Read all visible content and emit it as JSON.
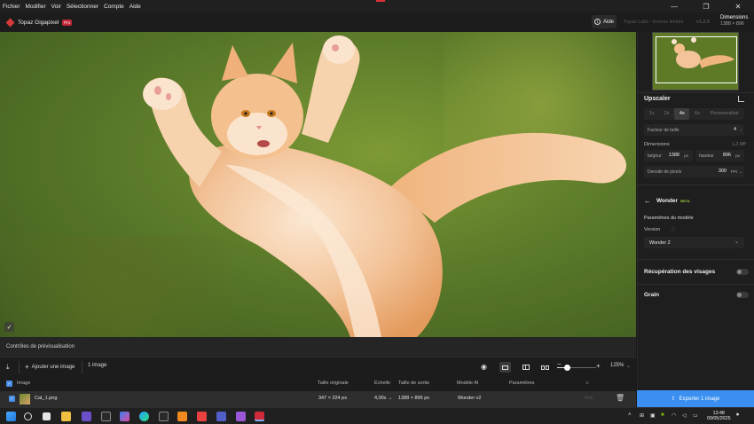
{
  "menubar": {
    "items": [
      "Fichier",
      "Modifier",
      "Voir",
      "Sélectionner",
      "Compte",
      "Aide"
    ]
  },
  "window_controls": {
    "minimize": "—",
    "maximize": "❐",
    "close": "✕"
  },
  "appbar": {
    "title": "Topaz Gigapixel",
    "badge": "Pro",
    "help_label": "Aide",
    "help_icon": "info-icon",
    "brand_text": "Topaz Labs - license limitée",
    "version": "v1.2.0",
    "dimensions_title": "Dimensions",
    "dimensions_value": "1388 × 896"
  },
  "preview": {
    "controls_label": "Contrôles de prévisualisation"
  },
  "toolbar": {
    "add_image_label": "Ajouter une image",
    "image_count": "1 image",
    "zoom_value": "125%",
    "zoom_fraction": 0.25
  },
  "table": {
    "headers": {
      "image": "Image",
      "original_size": "Taille originale",
      "scale": "Échelle",
      "output_size": "Taille de sortie",
      "ai_model": "Modèle AI",
      "parameters": "Paramètres"
    },
    "rows": [
      {
        "name": "Cat_1.png",
        "original_size": "347 × 224 px",
        "scale": "4,00x →",
        "output_size": "1388 × 896 px",
        "ai_model": "Wonder v2",
        "parameters": "",
        "status": "Noir"
      }
    ]
  },
  "upscaler": {
    "title": "Upscaler",
    "scale_options": [
      "1x",
      "2x",
      "4x",
      "6x",
      "Personnalisé"
    ],
    "selected_scale": "4x",
    "scale_factor_label": "Facteur de taille",
    "scale_factor_value": "4",
    "dimensions_label": "Dimensions",
    "dimensions_size": "1,2 MP",
    "width_label": "largeur",
    "width_value": "1388",
    "width_unit": "px",
    "height_label": "hauteur",
    "height_value": "896",
    "height_unit": "px",
    "density_label": "Densité de pixels",
    "density_value": "300",
    "density_unit": "PPI"
  },
  "model": {
    "name": "Wonder",
    "badge": "BETA",
    "params_title": "Paramètres du modèle",
    "version_label": "Version",
    "version_value": "Wonder 2"
  },
  "face_recovery": {
    "label": "Récupération des visages",
    "enabled": false
  },
  "grain": {
    "label": "Grain",
    "enabled": false
  },
  "export": {
    "label": "Exporter 1 image"
  },
  "taskbar": {
    "time": "13:48",
    "date": "09/05/2025"
  }
}
